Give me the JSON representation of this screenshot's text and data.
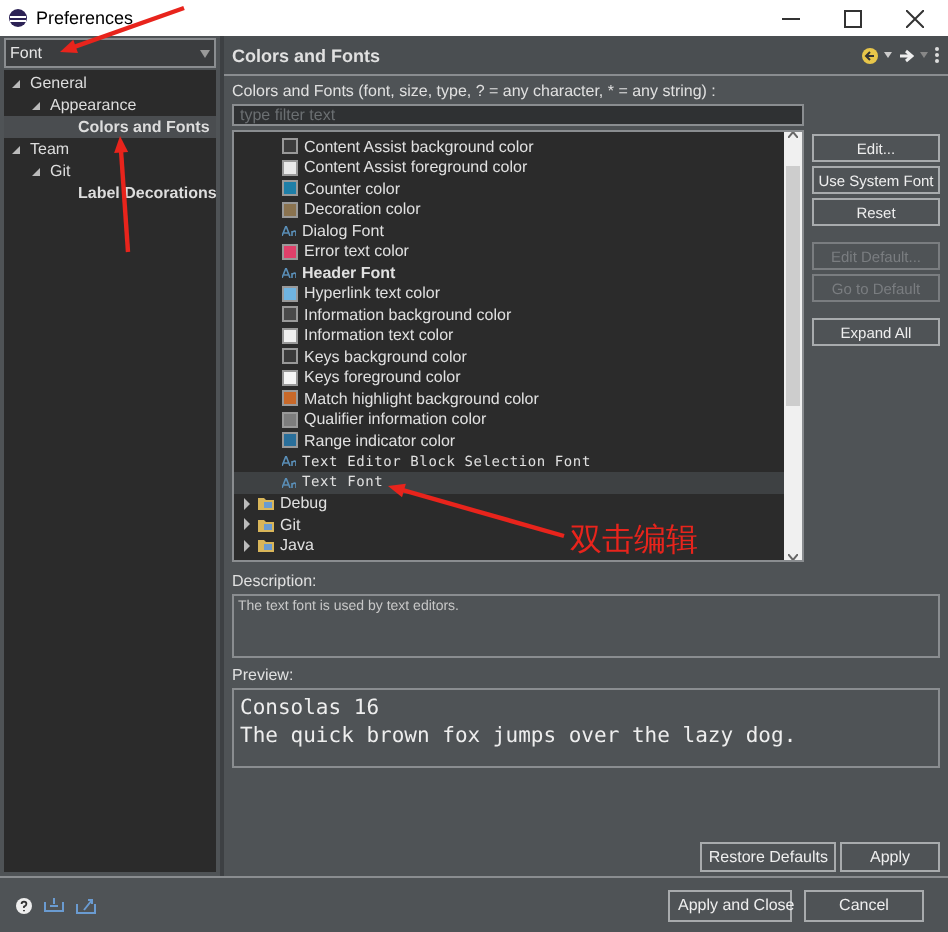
{
  "window": {
    "title": "Preferences"
  },
  "nav": {
    "filter": "Font",
    "items": [
      {
        "label": "General",
        "expanded": true,
        "selected": false,
        "match": false,
        "children": [
          {
            "label": "Appearance",
            "expanded": true,
            "selected": false,
            "match": false,
            "children": [
              {
                "label": "Colors and Fonts",
                "selected": true,
                "match": true
              }
            ]
          }
        ]
      },
      {
        "label": "Team",
        "expanded": true,
        "selected": false,
        "match": false,
        "children": [
          {
            "label": "Git",
            "expanded": true,
            "selected": false,
            "match": false,
            "children": [
              {
                "label": "Label Decorations",
                "selected": false,
                "match": true
              }
            ]
          }
        ]
      }
    ]
  },
  "page": {
    "title": "Colors and Fonts",
    "hint": "Colors and Fonts (font, size, type, ? = any character, * = any string) :",
    "filter_placeholder": "type filter text",
    "tree": [
      {
        "kind": "color",
        "label": "Content Assist background color",
        "color": "#3c3c3c",
        "selected": false
      },
      {
        "kind": "color",
        "label": "Content Assist foreground color",
        "color": "#e8e8e8",
        "selected": false
      },
      {
        "kind": "color",
        "label": "Counter color",
        "color": "#1e7fa8",
        "selected": false
      },
      {
        "kind": "color",
        "label": "Decoration color",
        "color": "#8a7350",
        "selected": false
      },
      {
        "kind": "font",
        "label": "Dialog Font",
        "selected": false
      },
      {
        "kind": "color",
        "label": "Error text color",
        "color": "#e0406a",
        "selected": false
      },
      {
        "kind": "font",
        "label": "Header Font",
        "bold": true,
        "selected": false
      },
      {
        "kind": "color",
        "label": "Hyperlink text color",
        "color": "#6fb3e0",
        "selected": false
      },
      {
        "kind": "color",
        "label": "Information background color",
        "color": "#4a4a4a",
        "selected": false
      },
      {
        "kind": "color",
        "label": "Information text color",
        "color": "#f0f0f0",
        "selected": false
      },
      {
        "kind": "color",
        "label": "Keys background color",
        "color": "#3a3a3a",
        "selected": false
      },
      {
        "kind": "color",
        "label": "Keys foreground color",
        "color": "#f5f5f5",
        "selected": false
      },
      {
        "kind": "color",
        "label": "Match highlight background color",
        "color": "#c8692a",
        "selected": false
      },
      {
        "kind": "color",
        "label": "Qualifier information color",
        "color": "#7d7d7d",
        "selected": false
      },
      {
        "kind": "color",
        "label": "Range indicator color",
        "color": "#2a6f9a",
        "selected": false
      },
      {
        "kind": "font",
        "label": "Text Editor Block Selection Font",
        "mono": true,
        "selected": false
      },
      {
        "kind": "font",
        "label": "Text Font",
        "mono": true,
        "selected": true
      },
      {
        "kind": "folder",
        "label": "Debug",
        "expanded": false,
        "selected": false
      },
      {
        "kind": "folder",
        "label": "Git",
        "expanded": false,
        "selected": false
      },
      {
        "kind": "folder",
        "label": "Java",
        "expanded": false,
        "selected": false
      }
    ],
    "buttons": [
      {
        "label": "Edit...",
        "disabled": false
      },
      {
        "label": "Use System Font",
        "disabled": false
      },
      {
        "label": "Reset",
        "disabled": false
      },
      {
        "label": "Edit Default...",
        "disabled": true
      },
      {
        "label": "Go to Default",
        "disabled": true
      },
      {
        "label": "Expand All",
        "disabled": false
      }
    ],
    "description_label": "Description:",
    "description": "The text font is used by text editors.",
    "preview_label": "Preview:",
    "preview": [
      "Consolas 16",
      "The quick brown fox jumps over the lazy dog."
    ],
    "page_buttons": [
      "Restore Defaults",
      "Apply"
    ]
  },
  "footer": {
    "buttons": [
      "Apply and Close",
      "Cancel"
    ]
  },
  "annotation": {
    "text": "双击编辑"
  }
}
